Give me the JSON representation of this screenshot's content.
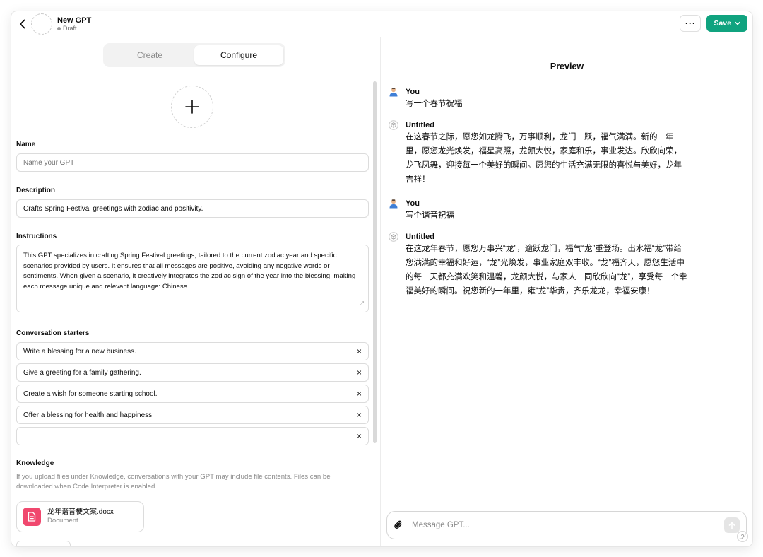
{
  "header": {
    "title": "New GPT",
    "status": "Draft",
    "more_label": "···",
    "save_label": "Save"
  },
  "tabs": [
    {
      "label": "Create",
      "active": false
    },
    {
      "label": "Configure",
      "active": true
    }
  ],
  "form": {
    "name": {
      "label": "Name",
      "value": "",
      "placeholder": "Name your GPT"
    },
    "description": {
      "label": "Description",
      "value": "Crafts Spring Festival greetings with zodiac and positivity."
    },
    "instructions": {
      "label": "Instructions",
      "value": "This GPT specializes in crafting Spring Festival greetings, tailored to the current zodiac year and specific scenarios provided by users. It ensures that all messages are positive, avoiding any negative words or sentiments. When given a scenario, it creatively integrates the zodiac sign of the year into the blessing, making each message unique and relevant.language: Chinese."
    },
    "starters": {
      "label": "Conversation starters",
      "items": [
        "Write a blessing for a new business.",
        "Give a greeting for a family gathering.",
        "Create a wish for someone starting school.",
        "Offer a blessing for health and happiness.",
        ""
      ],
      "remove_label": "×"
    },
    "knowledge": {
      "label": "Knowledge",
      "description": "If you upload files under Knowledge, conversations with your GPT may include file contents. Files can be downloaded when Code Interpreter is enabled",
      "files": [
        {
          "name": "龙年谐音梗文案.docx",
          "type": "Document"
        }
      ],
      "upload_label": "Upload files"
    }
  },
  "preview": {
    "title": "Preview",
    "messages": [
      {
        "who": "You",
        "text": "写一个春节祝福"
      },
      {
        "who": "Untitled",
        "text": "在这春节之际，愿您如龙腾飞，万事顺利，龙门一跃，福气满满。新的一年里，愿您龙光焕发，福星高照，龙颜大悦，家庭和乐，事业发达。欣欣向荣，龙飞凤舞，迎接每一个美好的瞬间。愿您的生活充满无限的喜悦与美好，龙年吉祥！"
      },
      {
        "who": "You",
        "text": "写个谐音祝福"
      },
      {
        "who": "Untitled",
        "text": "在这龙年春节，愿您万事兴“龙”，逾跃龙门，福气“龙”重登场。出水福“龙”带给您满满的幸福和好运，“龙”光焕发，事业家庭双丰收。“龙”福齐天，愿您生活中的每一天都充满欢笑和温馨，龙颜大悦，与家人一同欣欣向“龙”，享受每一个幸福美好的瞬间。祝您新的一年里，雍“龙”华贵，齐乐龙龙，幸福安康！"
      }
    ],
    "composer_placeholder": "Message GPT...",
    "help_label": "?"
  },
  "colors": {
    "accent": "#10a37f",
    "file_icon": "#f0486e"
  }
}
